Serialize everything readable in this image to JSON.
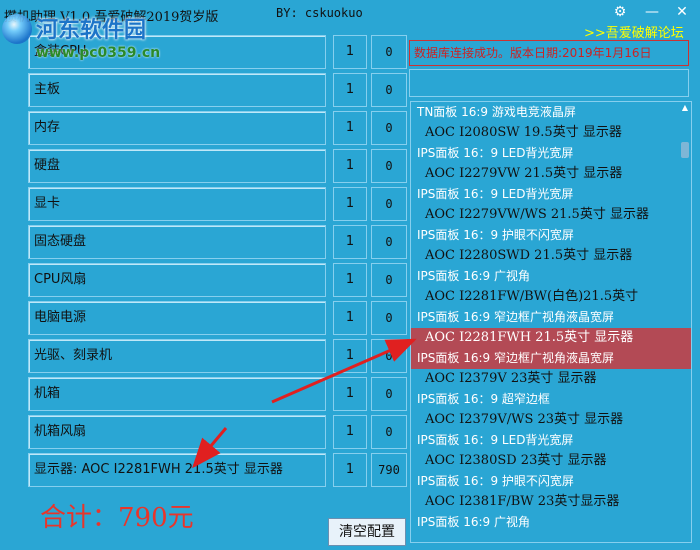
{
  "window": {
    "title": "攒机助理  V1.0  吾爱破解2019贺岁版",
    "author": "BY: cskuokuo",
    "gear_symbol": "⚙",
    "close_symbol": "✕",
    "forum_link": ">>吾爱破解论坛"
  },
  "watermark": {
    "title": "河东软件园",
    "url": "www.pc0359.cn"
  },
  "status_message": "数据库连接成功。版本日期:2019年1月16日",
  "components": [
    {
      "label": "盒装CPU",
      "qty": "1",
      "price": "0"
    },
    {
      "label": "主板",
      "qty": "1",
      "price": "0"
    },
    {
      "label": "内存",
      "qty": "1",
      "price": "0"
    },
    {
      "label": "硬盘",
      "qty": "1",
      "price": "0"
    },
    {
      "label": "显卡",
      "qty": "1",
      "price": "0"
    },
    {
      "label": "固态硬盘",
      "qty": "1",
      "price": "0"
    },
    {
      "label": "CPU风扇",
      "qty": "1",
      "price": "0"
    },
    {
      "label": "电脑电源",
      "qty": "1",
      "price": "0"
    },
    {
      "label": "光驱、刻录机",
      "qty": "1",
      "price": "0"
    },
    {
      "label": "机箱",
      "qty": "1",
      "price": "0"
    },
    {
      "label": "机箱风扇",
      "qty": "1",
      "price": "0"
    },
    {
      "label": "显示器: AOC  I2281FWH  21.5英寸 显示器",
      "qty": "1",
      "price": "790"
    }
  ],
  "product_list": [
    {
      "text": "TN面板 16:9 游戏电竞液晶屏",
      "kind": "desc",
      "selected": false
    },
    {
      "text": "AOC  I2080SW  19.5英寸 显示器",
      "kind": "name",
      "selected": false
    },
    {
      "text": "IPS面板 16：9 LED背光宽屏",
      "kind": "desc",
      "selected": false
    },
    {
      "text": "AOC  I2279VW  21.5英寸 显示器",
      "kind": "name",
      "selected": false
    },
    {
      "text": "IPS面板 16：9 LED背光宽屏",
      "kind": "desc",
      "selected": false
    },
    {
      "text": "AOC  I2279VW/WS  21.5英寸 显示器",
      "kind": "name",
      "selected": false
    },
    {
      "text": "IPS面板 16：9 护眼不闪宽屏",
      "kind": "desc",
      "selected": false
    },
    {
      "text": "AOC  I2280SWD  21.5英寸 显示器",
      "kind": "name",
      "selected": false
    },
    {
      "text": "IPS面板 16:9 广视角",
      "kind": "desc",
      "selected": false
    },
    {
      "text": "AOC  I2281FW/BW(白色)21.5英寸",
      "kind": "name",
      "selected": false
    },
    {
      "text": "IPS面板 16:9 窄边框广视角液晶宽屏",
      "kind": "desc",
      "selected": false
    },
    {
      "text": "AOC  I2281FWH  21.5英寸 显示器",
      "kind": "name",
      "selected": true
    },
    {
      "text": "IPS面板 16:9 窄边框广视角液晶宽屏",
      "kind": "desc",
      "selected": true
    },
    {
      "text": "AOC  I2379V  23英寸 显示器",
      "kind": "name",
      "selected": false
    },
    {
      "text": "IPS面板 16：9 超窄边框",
      "kind": "desc",
      "selected": false
    },
    {
      "text": "AOC  I2379V/WS  23英寸 显示器",
      "kind": "name",
      "selected": false
    },
    {
      "text": "IPS面板 16：9 LED背光宽屏",
      "kind": "desc",
      "selected": false
    },
    {
      "text": "AOC  I2380SD  23英寸 显示器",
      "kind": "name",
      "selected": false
    },
    {
      "text": "IPS面板 16：9 护眼不闪宽屏",
      "kind": "desc",
      "selected": false
    },
    {
      "text": "AOC  I2381F/BW  23英寸显示器",
      "kind": "name",
      "selected": false
    },
    {
      "text": "IPS面板 16:9 广视角",
      "kind": "desc",
      "selected": false
    }
  ],
  "total_label": "合计：790元",
  "clear_button": "清空配置",
  "colors": {
    "background": "#2aa6d4",
    "selection": "#b34a55",
    "status_text": "#cc2222",
    "total_text": "#e8352b",
    "link": "#ffff00",
    "arrow": "#e02020"
  }
}
